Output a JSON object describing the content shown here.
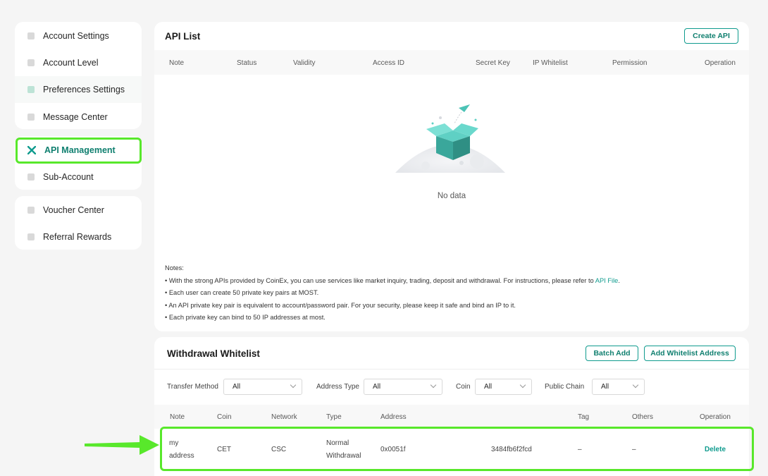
{
  "sidebar": {
    "items": [
      {
        "label": "Account Settings"
      },
      {
        "label": "Account Level"
      },
      {
        "label": "Preferences Settings"
      },
      {
        "label": "Message Center"
      },
      {
        "label": "API Management"
      },
      {
        "label": "Sub-Account"
      },
      {
        "label": "Voucher Center"
      },
      {
        "label": "Referral Rewards"
      }
    ],
    "active_item": "API Management"
  },
  "api_list": {
    "title": "API List",
    "create_button": "Create API",
    "columns": [
      "Note",
      "Status",
      "Validity",
      "Access ID",
      "Secret Key",
      "IP Whitelist",
      "Permission",
      "Operation"
    ],
    "empty_text": "No data",
    "notes": {
      "heading": "Notes:",
      "lines": [
        "• With the strong APIs provided by CoinEx, you can use services like market inquiry, trading, deposit and withdrawal. For instructions, please refer to ",
        "• Each user can create 50 private key pairs at MOST.",
        "• An API private key pair is equivalent to account/password pair. For your security, please keep it safe and bind an IP to it.",
        "• Each private key can bind to 50 IP addresses at most."
      ],
      "link_text": "API File",
      "link_suffix": "."
    }
  },
  "whitelist": {
    "title": "Withdrawal Whitelist",
    "batch_add_button": "Batch Add",
    "add_button": "Add Whitelist Address",
    "filters": {
      "transfer_method": {
        "label": "Transfer Method",
        "value": "All"
      },
      "address_type": {
        "label": "Address Type",
        "value": "All"
      },
      "coin": {
        "label": "Coin",
        "value": "All"
      },
      "public_chain": {
        "label": "Public Chain",
        "value": "All"
      }
    },
    "columns": [
      "Note",
      "Coin",
      "Network",
      "Type",
      "Address",
      "Tag",
      "Others",
      "Operation"
    ],
    "rows": [
      {
        "note_line1": "my",
        "note_line2": "address",
        "coin": "CET",
        "network": "CSC",
        "type_line1": "Normal",
        "type_line2": "Withdrawal",
        "address_start": "0x0051f",
        "address_end": "3484fb6f2fcd",
        "tag": "–",
        "others": "–",
        "operation": "Delete"
      }
    ]
  },
  "colors": {
    "accent": "#0f9b8e",
    "highlight": "#58e82b",
    "background": "#f5f5f5"
  }
}
